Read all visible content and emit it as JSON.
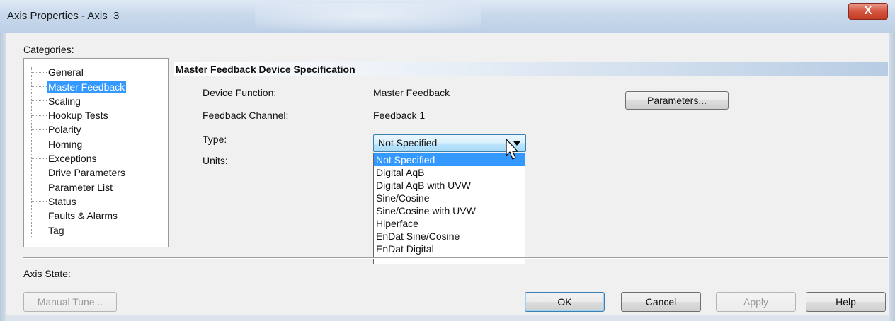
{
  "window": {
    "title": "Axis Properties - Axis_3",
    "close_glyph": "X"
  },
  "categories": {
    "label": "Categories:",
    "items": [
      {
        "label": "General",
        "selected": false
      },
      {
        "label": "Master Feedback",
        "selected": true
      },
      {
        "label": "Scaling",
        "selected": false
      },
      {
        "label": "Hookup Tests",
        "selected": false
      },
      {
        "label": "Polarity",
        "selected": false
      },
      {
        "label": "Homing",
        "selected": false
      },
      {
        "label": "Exceptions",
        "selected": false
      },
      {
        "label": "Drive Parameters",
        "selected": false
      },
      {
        "label": "Parameter List",
        "selected": false
      },
      {
        "label": "Status",
        "selected": false
      },
      {
        "label": "Faults & Alarms",
        "selected": false
      },
      {
        "label": "Tag",
        "selected": false
      }
    ]
  },
  "section": {
    "title": "Master Feedback Device Specification"
  },
  "fields": {
    "device_function_label": "Device Function:",
    "device_function_value": "Master Feedback",
    "feedback_channel_label": "Feedback Channel:",
    "feedback_channel_value": "Feedback 1",
    "type_label": "Type:",
    "type_value": "Not Specified",
    "units_label": "Units:"
  },
  "type_options": [
    "Not Specified",
    "Digital AqB",
    "Digital AqB with UVW",
    "Sine/Cosine",
    "Sine/Cosine with UVW",
    "Hiperface",
    "EnDat Sine/Cosine",
    "EnDat Digital"
  ],
  "buttons": {
    "parameters": "Parameters...",
    "manual_tune": "Manual Tune...",
    "ok": "OK",
    "cancel": "Cancel",
    "apply": "Apply",
    "help": "Help"
  },
  "axis_state": {
    "label": "Axis State:"
  },
  "icons": {
    "close": "close-icon",
    "dropdown": "chevron-down-icon",
    "cursor": "mouse-pointer-icon"
  }
}
